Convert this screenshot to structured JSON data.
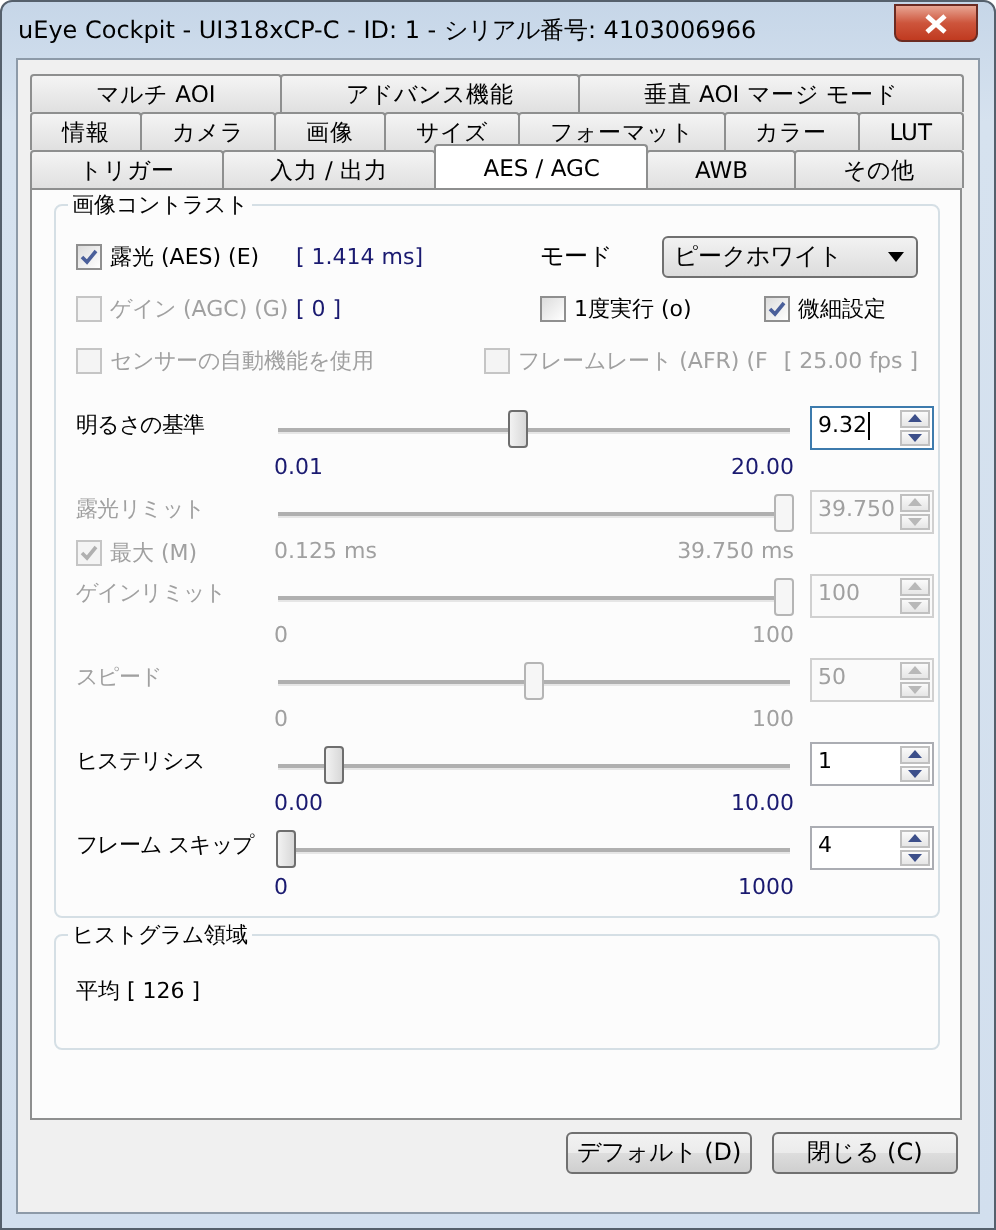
{
  "window": {
    "title": "uEye Cockpit - UI318xCP-C - ID: 1 - シリアル番号: 4103006966"
  },
  "tab_rows": [
    [
      {
        "label": "マルチ AOI",
        "selected": false
      },
      {
        "label": "アドバンス機能",
        "selected": false
      },
      {
        "label": "垂直 AOI マージ モード",
        "selected": false
      }
    ],
    [
      {
        "label": "情報",
        "selected": false
      },
      {
        "label": "カメラ",
        "selected": false
      },
      {
        "label": "画像",
        "selected": false
      },
      {
        "label": "サイズ",
        "selected": false
      },
      {
        "label": "フォーマット",
        "selected": false
      },
      {
        "label": "カラー",
        "selected": false
      },
      {
        "label": "LUT",
        "selected": false
      }
    ],
    [
      {
        "label": "トリガー",
        "selected": false
      },
      {
        "label": "入力 / 出力",
        "selected": false
      },
      {
        "label": "AES / AGC",
        "selected": true
      },
      {
        "label": "AWB",
        "selected": false
      },
      {
        "label": "その他",
        "selected": false
      }
    ]
  ],
  "image_contrast": {
    "title": "画像コントラスト",
    "exposure": {
      "label": "露光 (AES) (E)",
      "checked": true,
      "disabled": false,
      "reading": "[ 1.414 ms]"
    },
    "mode": {
      "label": "モード",
      "value": "ピークホワイト"
    },
    "gain": {
      "label": "ゲイン (AGC) (G)",
      "checked": false,
      "disabled": true,
      "reading": "[ 0 ]"
    },
    "once": {
      "label": "1度実行 (o)",
      "checked": false,
      "disabled": false
    },
    "fine": {
      "label": "微細設定",
      "checked": true,
      "disabled": false
    },
    "sensor": {
      "label": "センサーの自動機能を使用",
      "checked": false,
      "disabled": true
    },
    "framerate": {
      "label": "フレームレート (AFR) (F",
      "checked": false,
      "disabled": true,
      "reading": "[ 25.00 fps ]"
    },
    "sliders": [
      {
        "label": "明るさの基準",
        "disabled": false,
        "focused": true,
        "level": 0.466,
        "value": "9.32",
        "min": "0.01",
        "max": "20.00"
      },
      {
        "label": "露光リミット",
        "disabled": true,
        "focused": false,
        "level": 1,
        "value": "39.750",
        "min": "0.125 ms",
        "max": "39.750 ms",
        "option": {
          "label": "最大 (M)",
          "checked": true,
          "disabled": true
        }
      },
      {
        "label": "ゲインリミット",
        "disabled": true,
        "focused": false,
        "level": 1,
        "value": "100",
        "min": "0",
        "max": "100"
      },
      {
        "label": "スピード",
        "disabled": true,
        "focused": false,
        "level": 0.5,
        "value": "50",
        "min": "0",
        "max": "100"
      },
      {
        "label": "ヒステリシス",
        "disabled": false,
        "focused": false,
        "level": 0.1,
        "value": "1",
        "min": "0.00",
        "max": "10.00"
      },
      {
        "label": "フレーム スキップ",
        "disabled": false,
        "focused": false,
        "level": 0.004,
        "value": "4",
        "min": "0",
        "max": "1000"
      }
    ]
  },
  "histogram": {
    "title": "ヒストグラム領域",
    "mean": "平均 [ 126 ]"
  },
  "buttons": [
    "デフォルト (D)",
    "閉じる (C)"
  ]
}
